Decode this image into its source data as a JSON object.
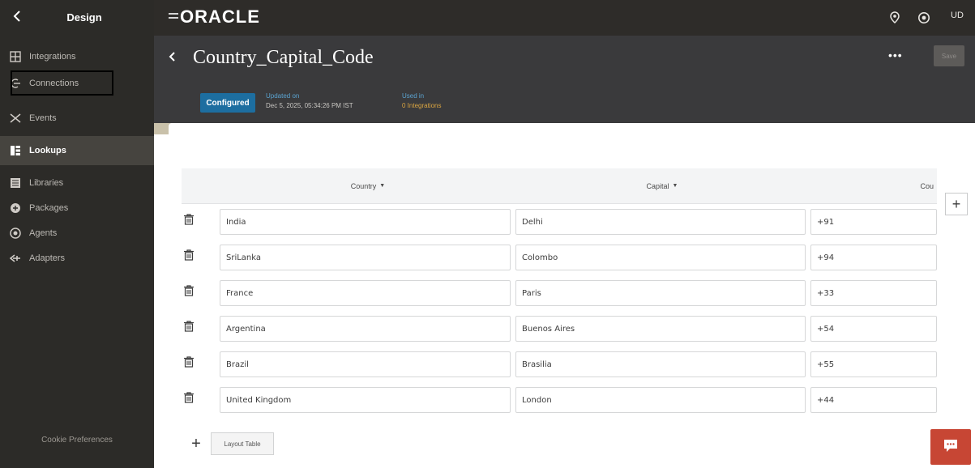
{
  "sidebar": {
    "back_icon": "chevron-left-icon",
    "title": "Design",
    "items": [
      {
        "label": "Integrations",
        "icon": "integrations-icon"
      },
      {
        "label": "Connections",
        "icon": "connections-icon"
      },
      {
        "label": "Events",
        "icon": "events-icon"
      },
      {
        "label": "Lookups",
        "icon": "lookups-icon"
      },
      {
        "label": "Libraries",
        "icon": "libraries-icon"
      },
      {
        "label": "Packages",
        "icon": "packages-icon"
      },
      {
        "label": "Agents",
        "icon": "agents-icon"
      },
      {
        "label": "Adapters",
        "icon": "adapters-icon"
      }
    ],
    "active_item": "Lookups",
    "footer": "Cookie Preferences"
  },
  "topbar": {
    "brand": "ORACLE",
    "user_initials": "UD",
    "icons": [
      "hamburger-icon",
      "location-icon",
      "help-icon"
    ]
  },
  "header": {
    "title": "Country_Capital_Code",
    "more_label": "•••",
    "save_label": "Save",
    "status_badge": "Configured",
    "updated_label": "Updated on",
    "updated_value": "Dec 5, 2025, 05:34:26 PM IST",
    "used_in_label": "Used in",
    "used_in_value": "0 Integrations"
  },
  "table": {
    "columns": [
      "Country",
      "Capital",
      "Cou"
    ],
    "rows": [
      {
        "country": "India",
        "capital": "Delhi",
        "code": "+91"
      },
      {
        "country": "SriLanka",
        "capital": "Colombo",
        "code": "+94"
      },
      {
        "country": "France",
        "capital": "Paris",
        "code": "+33"
      },
      {
        "country": "Argentina",
        "capital": "Buenos Aires",
        "code": "+54"
      },
      {
        "country": "Brazil",
        "capital": "Brasilia",
        "code": "+55"
      },
      {
        "country": "United Kingdom",
        "capital": "London",
        "code": "+44"
      }
    ],
    "add_column_icon": "plus-icon",
    "add_row_icon": "plus-icon",
    "layout_button": "Layout Table"
  },
  "colors": {
    "sidebar_bg": "#2c2b28",
    "header_bg": "#3a3a3c",
    "badge_bg": "#1d6ea0",
    "chat_bg": "#c74634"
  }
}
